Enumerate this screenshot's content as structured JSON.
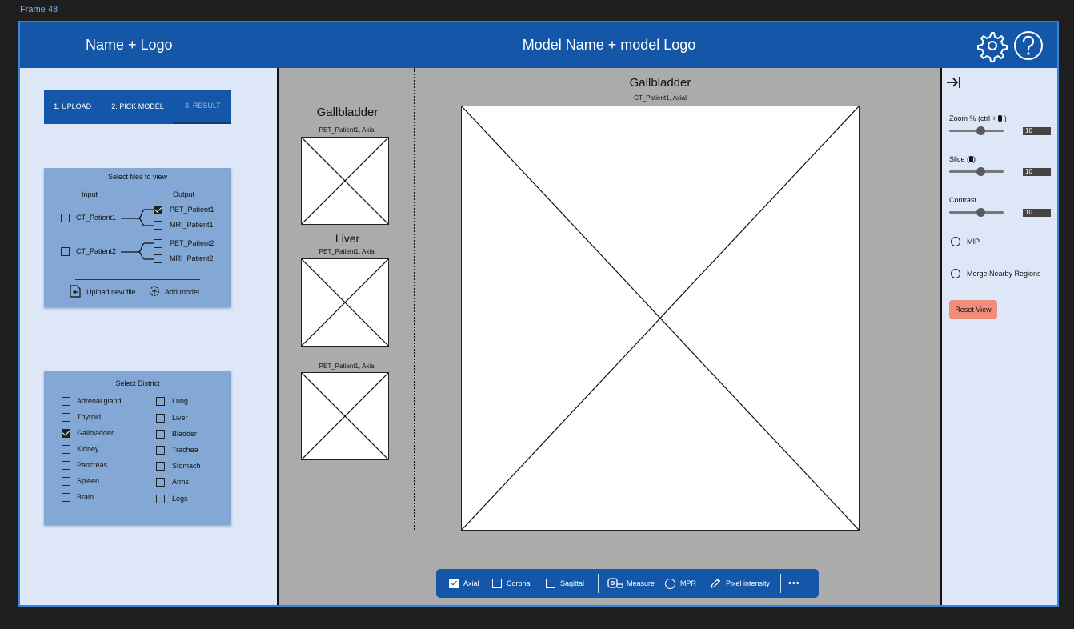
{
  "frame_label": "Frame 48",
  "header": {
    "brand": "Name + Logo",
    "model": "Model Name + model Logo",
    "settings_icon": "gear-icon",
    "help_icon": "help-icon"
  },
  "steps": [
    {
      "label": "1. UPLOAD"
    },
    {
      "label": "2. PICK MODEL"
    },
    {
      "label": "3. RESULT"
    }
  ],
  "files_card": {
    "title": "Select files to view",
    "input_header": "Input",
    "output_header": "Output",
    "inputs": [
      {
        "label": "CT_Patient1",
        "checked": false
      },
      {
        "label": "CT_Patient2",
        "checked": false
      }
    ],
    "outputs": [
      {
        "label": "PET_Patient1",
        "checked": true
      },
      {
        "label": "MRI_Patient1",
        "checked": false
      },
      {
        "label": "PET_Patient2",
        "checked": false
      },
      {
        "label": "MRI_Patient2",
        "checked": false
      }
    ],
    "upload_label": "Upload new file",
    "add_model_label": "Add model"
  },
  "district_card": {
    "title": "Select District",
    "col1": [
      {
        "label": "Adrenal gland",
        "checked": false
      },
      {
        "label": "Thyroid",
        "checked": false
      },
      {
        "label": "Gallbladder",
        "checked": true
      },
      {
        "label": "Kidney",
        "checked": false
      },
      {
        "label": "Pancreas",
        "checked": false
      },
      {
        "label": "Spleen",
        "checked": false
      },
      {
        "label": "Brain",
        "checked": false
      }
    ],
    "col2": [
      {
        "label": "Lung",
        "checked": false
      },
      {
        "label": "Liver",
        "checked": false
      },
      {
        "label": "Bladder",
        "checked": false
      },
      {
        "label": "Trachea",
        "checked": false
      },
      {
        "label": "Stomach",
        "checked": false
      },
      {
        "label": "Arms",
        "checked": false
      },
      {
        "label": "Legs",
        "checked": false
      }
    ]
  },
  "thumbnails": [
    {
      "title": "Gallbladder",
      "subtitle": "PET_Patient1, Axial"
    },
    {
      "title": "Liver",
      "subtitle": "PET_Patient1, Axial"
    },
    {
      "title": "",
      "subtitle": "PET_Patient1, Axial"
    }
  ],
  "viewer": {
    "title": "Gallbladder",
    "subtitle": "CT_Patient1, Axial"
  },
  "toolbar": {
    "axial": "Axial",
    "coronal": "Coronal",
    "sagittal": "Sagittal",
    "measure": "Measure",
    "mpr": "MPR",
    "pixel_intensity": "Pixel intensity",
    "more": "•••"
  },
  "right_panel": {
    "zoom_label": "Zoom % (ctrl + ",
    "zoom_value": "10",
    "slice_label": "Slice (",
    "slice_value": "10",
    "contrast_label": "Contrast",
    "contrast_value": "10",
    "mip_label": "MIP",
    "merge_label": "Merge Nearby Regions",
    "reset_label": "Reset View"
  },
  "colors": {
    "brand_blue": "#1456a8",
    "panel_bg": "#dde7f7",
    "card_bg": "#84a8d6",
    "viewer_bg": "#ababab",
    "reset_btn": "#f08e7a"
  }
}
